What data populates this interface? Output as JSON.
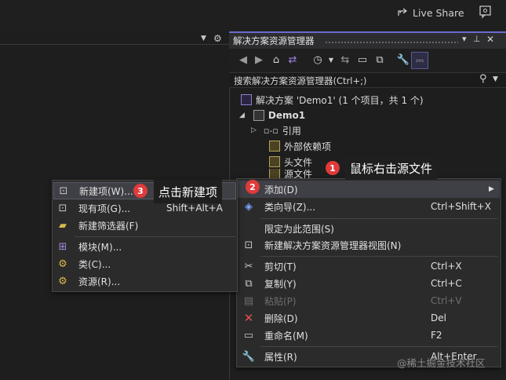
{
  "topbar": {
    "liveshare_label": "Live Share"
  },
  "solution_explorer": {
    "title": "解决方案资源管理器",
    "search_placeholder": "搜索解决方案资源管理器(Ctrl+;)",
    "tree": {
      "solution": "解决方案 'Demo1' (1 个项目，共 1 个)",
      "project": "Demo1",
      "references": "引用",
      "external_deps": "外部依赖项",
      "header_files": "头文件",
      "source_files": "源文件"
    }
  },
  "main_menu": {
    "add": "添加(D)",
    "class_wizard": {
      "label": "类向导(Z)...",
      "shortcut": "Ctrl+Shift+X"
    },
    "scope_to_this": "限定为此范围(S)",
    "new_view": "新建解决方案资源管理器视图(N)",
    "cut": {
      "label": "剪切(T)",
      "shortcut": "Ctrl+X"
    },
    "copy": {
      "label": "复制(Y)",
      "shortcut": "Ctrl+C"
    },
    "paste": {
      "label": "粘贴(P)",
      "shortcut": "Ctrl+V"
    },
    "delete": {
      "label": "删除(D)",
      "shortcut": "Del"
    },
    "rename": {
      "label": "重命名(M)",
      "shortcut": "F2"
    },
    "properties": {
      "label": "属性(R)",
      "shortcut": "Alt+Enter"
    }
  },
  "add_submenu": {
    "new_item": "新建项(W)...",
    "existing_item": {
      "label": "现有项(G)...",
      "shortcut": "Shift+Alt+A"
    },
    "new_filter": "新建筛选器(F)",
    "module": "模块(M)...",
    "class": "类(C)...",
    "resource": "资源(R)..."
  },
  "callouts": [
    {
      "number": "1",
      "text": "鼠标右击源文件"
    },
    {
      "number": "2",
      "text": ""
    },
    {
      "number": "3",
      "text": "点击新建项"
    }
  ],
  "watermark": "@稀土掘金技术社区"
}
